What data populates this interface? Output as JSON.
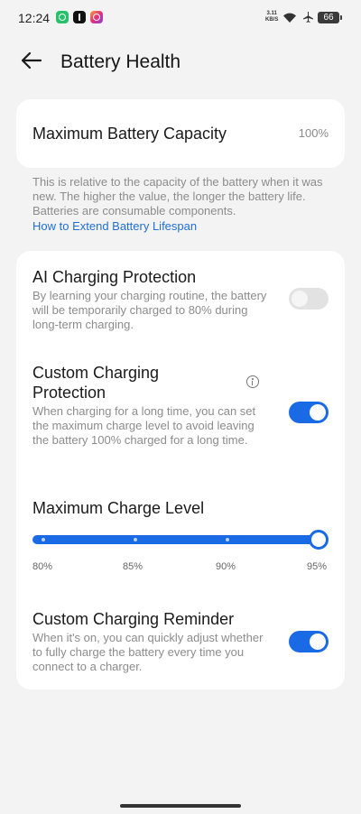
{
  "status_bar": {
    "time": "12:24",
    "net_speed_value": "3.11",
    "net_speed_unit": "KB/S",
    "battery": "66",
    "icons": [
      "whatsapp-icon",
      "tiktok-icon",
      "instagram-icon",
      "wifi-icon",
      "airplane-icon",
      "battery-icon"
    ]
  },
  "header": {
    "title": "Battery Health"
  },
  "capacity": {
    "label": "Maximum Battery Capacity",
    "value": "100%"
  },
  "info": {
    "text": "This is relative to the capacity of the battery when it was new. The higher the value, the longer the battery life. Batteries are consumable components.",
    "link": "How to Extend Battery Lifespan"
  },
  "settings": {
    "ai_protection": {
      "title": "AI Charging Protection",
      "description": "By learning your charging routine, the battery will be temporarily charged to 80% during long-term charging.",
      "enabled": false
    },
    "custom_protection": {
      "title_line1": "Custom Charging",
      "title_line2": "Protection",
      "description": "When charging for a long time, you can set the maximum charge level to avoid leaving the battery 100% charged for a long time.",
      "enabled": true
    },
    "max_charge": {
      "title": "Maximum Charge Level",
      "ticks": [
        "80%",
        "85%",
        "90%",
        "95%"
      ],
      "selected": "95%",
      "selected_fraction": 1.0
    },
    "reminder": {
      "title": "Custom Charging Reminder",
      "description": "When it's on, you can quickly adjust whether to fully charge the battery every time you connect to a charger.",
      "enabled": true
    }
  },
  "colors": {
    "accent": "#1a6ae6",
    "link": "#1f6fd6",
    "background": "#f3f3f3",
    "card": "#ffffff",
    "secondary_text": "#8c8c8c"
  }
}
